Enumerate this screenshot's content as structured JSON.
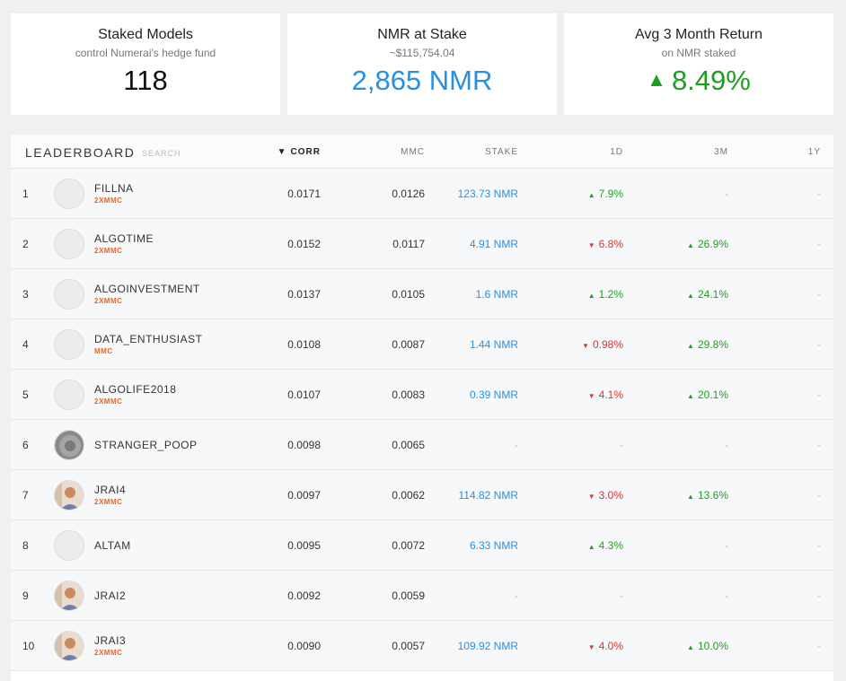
{
  "cards": [
    {
      "title": "Staked Models",
      "subtitle": "control Numerai's hedge fund",
      "value": "118",
      "arrow": ""
    },
    {
      "title": "NMR at Stake",
      "subtitle": "~$115,754.04",
      "value": "2,865 NMR",
      "arrow": ""
    },
    {
      "title": "Avg 3 Month Return",
      "subtitle": "on NMR staked",
      "value": "8.49%",
      "arrow": "▲"
    }
  ],
  "leaderboard": {
    "title": "LEADERBOARD",
    "search_placeholder": "SEARCH",
    "sort_indicator": "▼",
    "columns": {
      "corr": "CORR",
      "mmc": "MMC",
      "stake": "STAKE",
      "d1": "1D",
      "m3": "3M",
      "y1": "1Y"
    },
    "rows": [
      {
        "rank": "1",
        "name": "FILLNA",
        "tag": "2XMMC",
        "avatar": "blank",
        "corr": "0.0171",
        "mmc": "0.0126",
        "stake": "123.73 NMR",
        "d1": "7.9%",
        "d1_dir": "up",
        "m3": "-",
        "m3_dir": "none",
        "y1": "-"
      },
      {
        "rank": "2",
        "name": "ALGOTIME",
        "tag": "2XMMC",
        "avatar": "blank",
        "corr": "0.0152",
        "mmc": "0.0117",
        "stake": "4.91 NMR",
        "d1": "6.8%",
        "d1_dir": "down",
        "m3": "26.9%",
        "m3_dir": "up",
        "y1": "-"
      },
      {
        "rank": "3",
        "name": "ALGOINVESTMENT",
        "tag": "2XMMC",
        "avatar": "blank",
        "corr": "0.0137",
        "mmc": "0.0105",
        "stake": "1.6 NMR",
        "d1": "1.2%",
        "d1_dir": "up",
        "m3": "24.1%",
        "m3_dir": "up",
        "y1": "-"
      },
      {
        "rank": "4",
        "name": "DATA_ENTHUSIAST",
        "tag": "MMC",
        "avatar": "blank",
        "corr": "0.0108",
        "mmc": "0.0087",
        "stake": "1.44 NMR",
        "d1": "0.98%",
        "d1_dir": "down",
        "m3": "29.8%",
        "m3_dir": "up",
        "y1": "-"
      },
      {
        "rank": "5",
        "name": "ALGOLIFE2018",
        "tag": "2XMMC",
        "avatar": "blank",
        "corr": "0.0107",
        "mmc": "0.0083",
        "stake": "0.39 NMR",
        "d1": "4.1%",
        "d1_dir": "down",
        "m3": "20.1%",
        "m3_dir": "up",
        "y1": "-"
      },
      {
        "rank": "6",
        "name": "STRANGER_POOP",
        "tag": "",
        "avatar": "gray",
        "corr": "0.0098",
        "mmc": "0.0065",
        "stake": "-",
        "d1": "-",
        "d1_dir": "none",
        "m3": "-",
        "m3_dir": "none",
        "y1": "-"
      },
      {
        "rank": "7",
        "name": "JRAI4",
        "tag": "2XMMC",
        "avatar": "photo",
        "corr": "0.0097",
        "mmc": "0.0062",
        "stake": "114.82 NMR",
        "d1": "3.0%",
        "d1_dir": "down",
        "m3": "13.6%",
        "m3_dir": "up",
        "y1": "-"
      },
      {
        "rank": "8",
        "name": "ALTAM",
        "tag": "",
        "avatar": "blank",
        "corr": "0.0095",
        "mmc": "0.0072",
        "stake": "6.33 NMR",
        "d1": "4.3%",
        "d1_dir": "up",
        "m3": "-",
        "m3_dir": "none",
        "y1": "-"
      },
      {
        "rank": "9",
        "name": "JRAI2",
        "tag": "",
        "avatar": "photo",
        "corr": "0.0092",
        "mmc": "0.0059",
        "stake": "-",
        "d1": "-",
        "d1_dir": "none",
        "m3": "-",
        "m3_dir": "none",
        "y1": "-"
      },
      {
        "rank": "10",
        "name": "JRAI3",
        "tag": "2XMMC",
        "avatar": "photo",
        "corr": "0.0090",
        "mmc": "0.0057",
        "stake": "109.92 NMR",
        "d1": "4.0%",
        "d1_dir": "down",
        "m3": "10.0%",
        "m3_dir": "up",
        "y1": "-"
      }
    ]
  },
  "colors": {
    "blue": "#2b8fe0",
    "green": "#1e9e1e",
    "red": "#d53535",
    "tag_orange": "#e8632b"
  }
}
